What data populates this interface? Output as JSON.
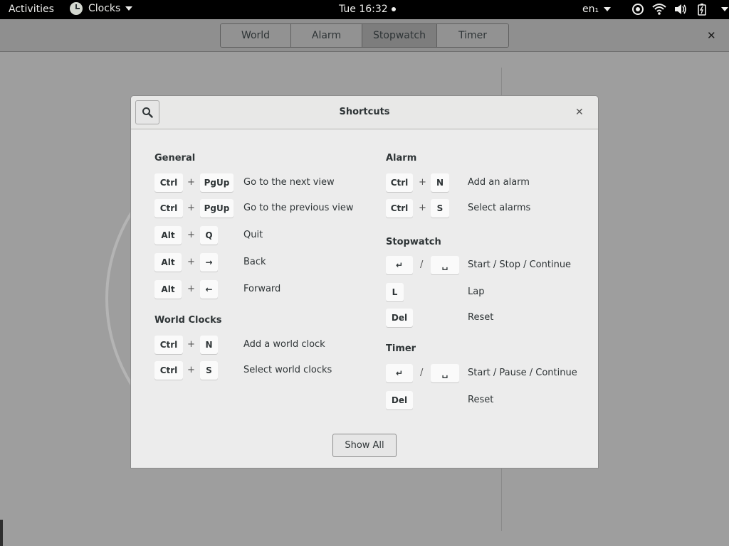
{
  "topbar": {
    "activities": "Activities",
    "app_name": "Clocks",
    "datetime": "Tue 16:32",
    "lang": "en₁"
  },
  "tabs": [
    "World",
    "Alarm",
    "Stopwatch",
    "Timer"
  ],
  "active_tab": "Stopwatch",
  "dialog": {
    "title": "Shortcuts",
    "show_all": "Show All",
    "general": {
      "title": "General",
      "rows": [
        {
          "keys": [
            "Ctrl",
            "PgUp"
          ],
          "sep": "+",
          "desc": "Go to the next view"
        },
        {
          "keys": [
            "Ctrl",
            "PgUp"
          ],
          "sep": "+",
          "desc": "Go to the previous view"
        },
        {
          "keys": [
            "Alt",
            "Q"
          ],
          "sep": "+",
          "desc": "Quit"
        },
        {
          "keys": [
            "Alt",
            "→"
          ],
          "sep": "+",
          "desc": "Back"
        },
        {
          "keys": [
            "Alt",
            "←"
          ],
          "sep": "+",
          "desc": "Forward"
        }
      ]
    },
    "world_clocks": {
      "title": "World Clocks",
      "rows": [
        {
          "keys": [
            "Ctrl",
            "N"
          ],
          "sep": "+",
          "desc": "Add a world clock"
        },
        {
          "keys": [
            "Ctrl",
            "S"
          ],
          "sep": "+",
          "desc": "Select world clocks"
        }
      ]
    },
    "alarm": {
      "title": "Alarm",
      "rows": [
        {
          "keys": [
            "Ctrl",
            "N"
          ],
          "sep": "+",
          "desc": "Add an alarm"
        },
        {
          "keys": [
            "Ctrl",
            "S"
          ],
          "sep": "+",
          "desc": "Select alarms"
        }
      ]
    },
    "stopwatch": {
      "title": "Stopwatch",
      "rows": [
        {
          "keys": [
            "↵",
            "␣"
          ],
          "sep": "/",
          "desc": "Start / Stop / Continue"
        },
        {
          "keys": [
            "L"
          ],
          "desc": "Lap"
        },
        {
          "keys": [
            "Del"
          ],
          "desc": "Reset"
        }
      ]
    },
    "timer": {
      "title": "Timer",
      "rows": [
        {
          "keys": [
            "↵",
            "␣"
          ],
          "sep": "/",
          "desc": "Start / Pause / Continue"
        },
        {
          "keys": [
            "Del"
          ],
          "desc": "Reset"
        }
      ]
    }
  }
}
